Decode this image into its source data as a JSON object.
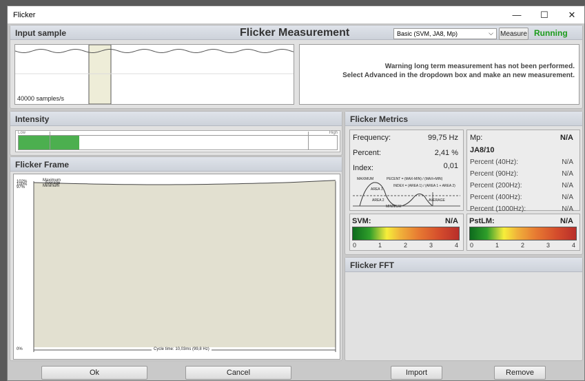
{
  "window": {
    "title": "Flicker",
    "minimize_glyph": "—",
    "maximize_glyph": "☐",
    "close_glyph": "✕"
  },
  "header": {
    "title": "Flicker Measurement",
    "mode_select": "Basic (SVM, JA8, Mp)",
    "measure_label": "Measure",
    "status": "Running",
    "status_color": "#1a9b1a"
  },
  "input_sample": {
    "title": "Input sample",
    "rate": "40000 samples/s",
    "warning_line1": "Warning long term measurement has not been performed.",
    "warning_line2": "Select Advanced in the dropdown box and make an new measurement."
  },
  "intensity": {
    "title": "Intensity",
    "low_label": "Low",
    "high_label": "High",
    "level_fraction": 0.19,
    "bar_color": "#4caf4f"
  },
  "flicker_frame": {
    "title": "Flicker Frame",
    "y_labels": [
      "102%",
      "100%",
      "97%",
      "0%"
    ],
    "legend": [
      "Maximum",
      "Average",
      "Minimum"
    ],
    "cycle_time": "Cycle time: 10,03ms (99,8 Hz)"
  },
  "metrics": {
    "title": "Flicker Metrics",
    "frequency_label": "Frequency:",
    "frequency_value": "99,75 Hz",
    "percent_label": "Percent:",
    "percent_value": "2,41 %",
    "index_label": "Index:",
    "index_value": "0,01",
    "diagram": {
      "maximum": "MAXIMUM",
      "minimum": "MINIMUM",
      "average": "AVERAGE",
      "area1": "AREA 1",
      "area2": "AREA 2",
      "percent_formula": "PECENT = (MAX-MIN) / (MAX+MIN)",
      "index_formula": "INDEX = (AREA 1) / (AREA 1 + AREA 2)"
    },
    "mp_label": "Mp:",
    "mp_value": "N/A",
    "ja8_title": "JA8/10",
    "ja8_rows": [
      {
        "label": "Percent (40Hz):",
        "value": "N/A"
      },
      {
        "label": "Percent (90Hz):",
        "value": "N/A"
      },
      {
        "label": "Percent (200Hz):",
        "value": "N/A"
      },
      {
        "label": "Percent (400Hz):",
        "value": "N/A"
      },
      {
        "label": "Percent (1000Hz):",
        "value": "N/A"
      }
    ],
    "svm_label": "SVM:",
    "svm_value": "N/A",
    "pstlm_label": "PstLM:",
    "pstlm_value": "N/A",
    "scale_ticks": [
      "0",
      "1",
      "2",
      "3",
      "4"
    ]
  },
  "fft": {
    "title": "Flicker FFT"
  },
  "footer": {
    "ok": "Ok",
    "cancel": "Cancel",
    "import": "Import",
    "remove": "Remove"
  }
}
